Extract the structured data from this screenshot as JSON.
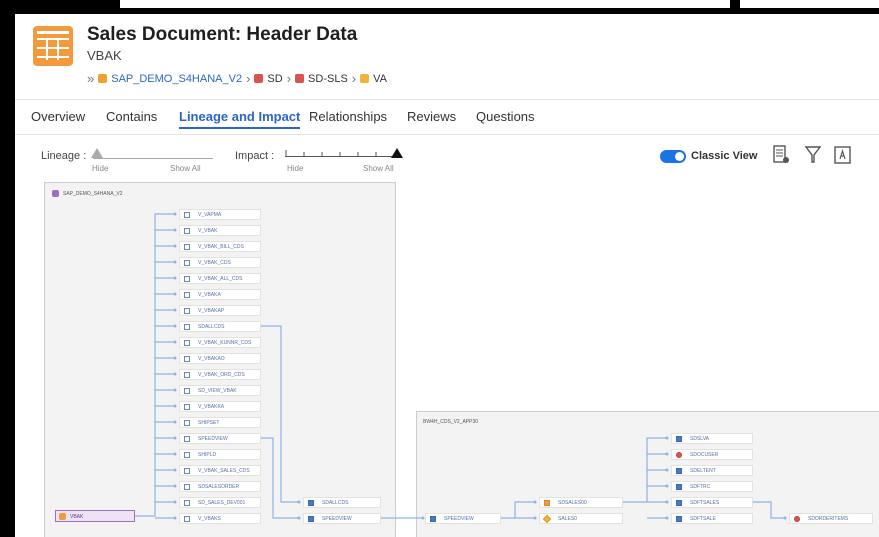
{
  "header": {
    "title": "Sales Document: Header Data",
    "subtitle": "VBAK",
    "breadcrumb": [
      "SAP_DEMO_S4HANA_V2",
      "SD",
      "SD-SLS",
      "VA"
    ]
  },
  "tabs": [
    {
      "label": "Overview",
      "active": false
    },
    {
      "label": "Contains",
      "active": false
    },
    {
      "label": "Lineage and Impact",
      "active": true
    },
    {
      "label": "Relationships",
      "active": false
    },
    {
      "label": "Reviews",
      "active": false
    },
    {
      "label": "Questions",
      "active": false
    }
  ],
  "toolbar": {
    "lineage_label": "Lineage :",
    "impact_label": "Impact :",
    "hide": "Hide",
    "show_all": "Show All",
    "classic_view": "Classic View",
    "classic_view_on": true
  },
  "graph": {
    "left_panel_title": "SAP_DEMO_S4HANA_V2",
    "right_panel_title": "BW4H_CDS_V2_APP30",
    "source_node": "VBAK",
    "left_nodes": [
      "V_VAPMA",
      "V_VBAK",
      "V_VBAK_BILL_CDS",
      "V_VBAK_CDS",
      "V_VBAK_ALL_CDS",
      "V_VBAKA",
      "V_VBAKAP",
      "SDALLCDS",
      "V_VBAK_KUNNR_CDS",
      "V_VBAKAO",
      "V_VBAK_ORD_CDS",
      "SD_VIEW_VBAK",
      "V_VBAKKA",
      "SHIPSET",
      "SPEEDVIEW",
      "SHIPLD",
      "V_VBAK_SALES_CDS",
      "SDSALESORDER",
      "SD_SALES_DEV001",
      "V_VBAKS"
    ],
    "middle_nodes": [
      "SDALLCDS",
      "SPEEDVIEW"
    ],
    "right_nodes": [
      "SPEEDVIEW",
      "SDSALES00",
      "SALES0"
    ],
    "far_right_nodes": [
      "SDSLVA",
      "SDOCUSER",
      "SDELTENT",
      "SDFTRC",
      "SDFTSALES",
      "SDFTSALE"
    ],
    "end_node": "SDORDERITEMS"
  }
}
